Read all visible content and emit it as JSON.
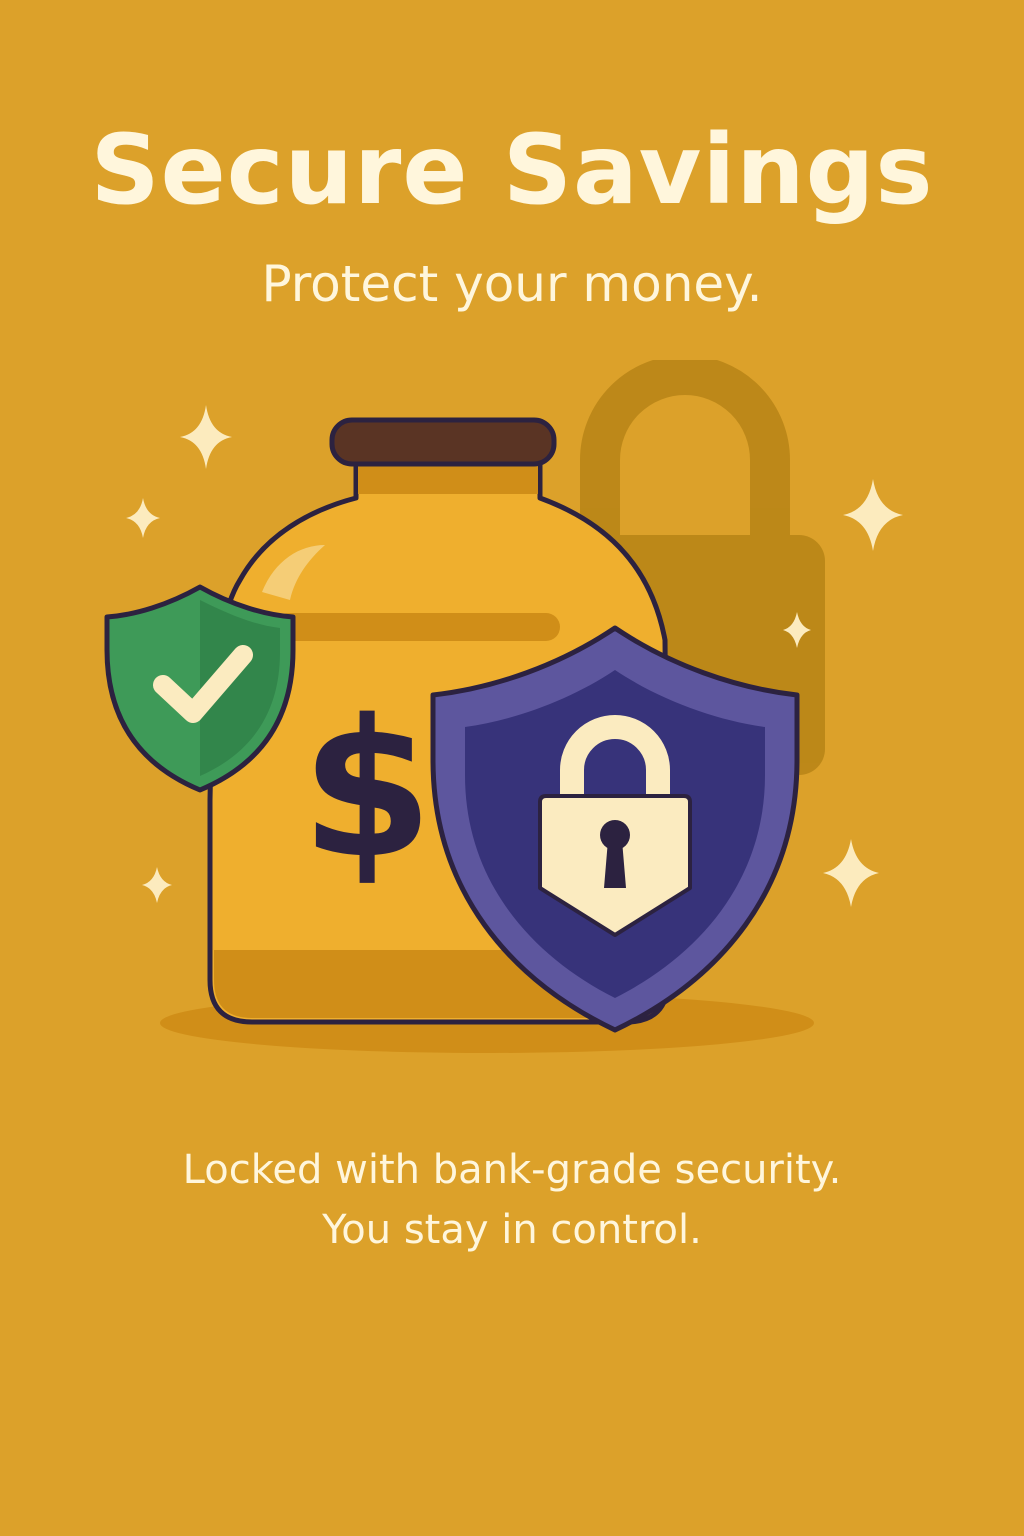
{
  "colors": {
    "background": "#DCA12A",
    "text_light": "#FFF6DC",
    "jar_body": "#EFAF2E",
    "jar_shade": "#D08E18",
    "jar_lid": "#5A3424",
    "outline": "#2C2240",
    "shield_green": "#3E9A58",
    "shield_green_dark": "#2E7E46",
    "shield_navy": "#37337A",
    "shield_purple": "#5D569E",
    "padlock_cream": "#FBEBC0",
    "background_padlock": "#B78416",
    "sparkle": "#FCEBBE"
  },
  "header": {
    "title": "Secure Savings",
    "subtitle": "Protect your money."
  },
  "illustration": {
    "jar_symbol": "$",
    "icons": [
      "savings-jar-icon",
      "check-shield-icon",
      "lock-shield-icon",
      "padlock-icon",
      "sparkle-icon"
    ]
  },
  "footer": {
    "line1": "Locked with bank-grade security.",
    "line2": "You stay in control."
  }
}
